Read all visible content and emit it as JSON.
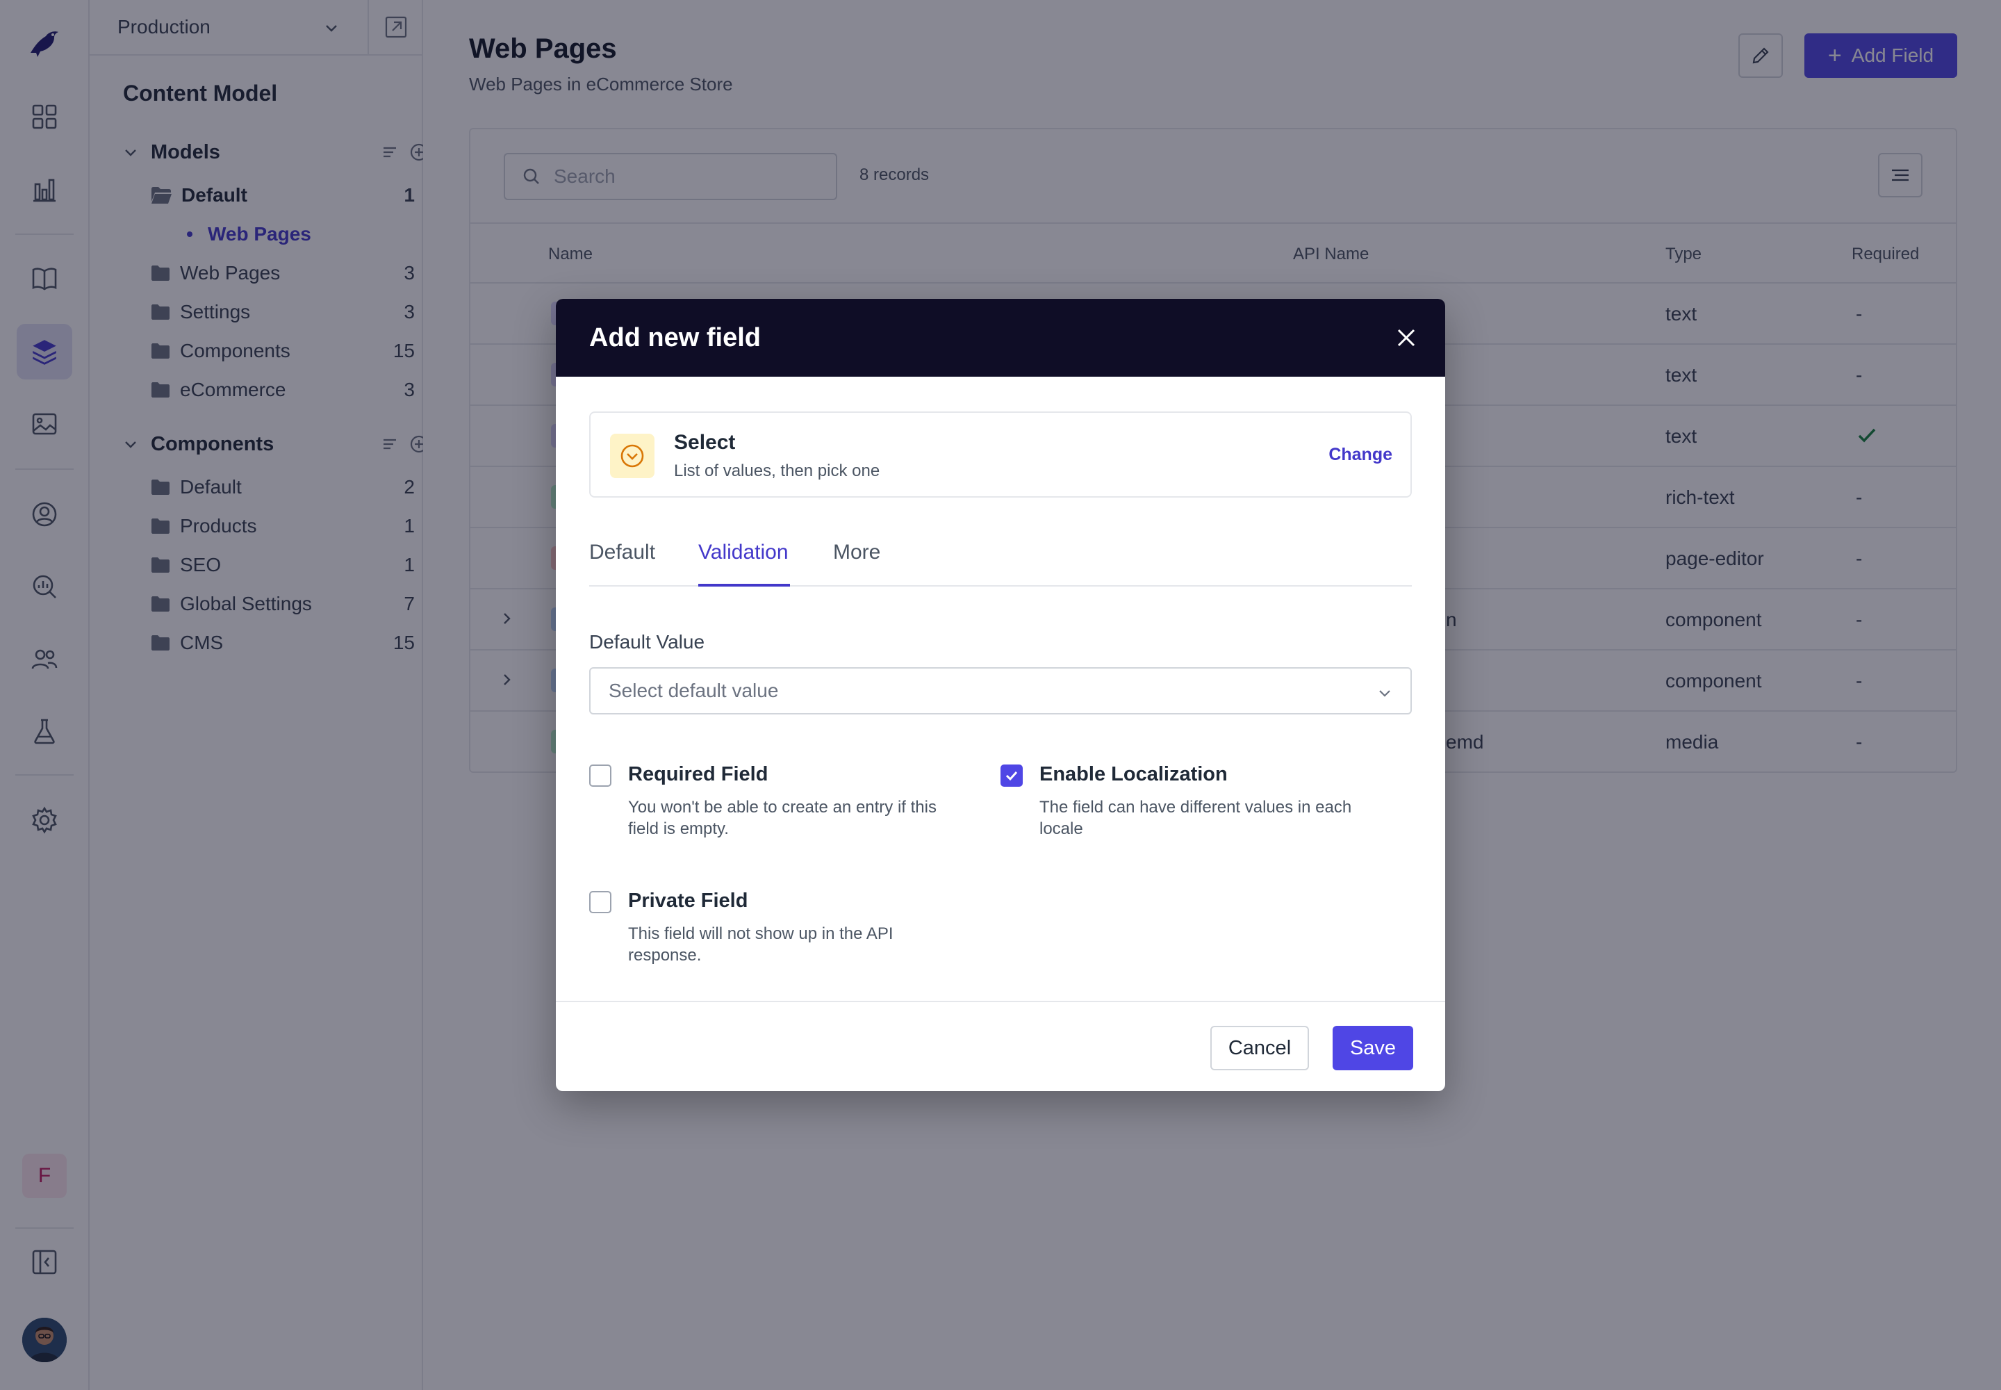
{
  "env": {
    "name": "Production"
  },
  "sidebar": {
    "title": "Content Model",
    "groups": [
      {
        "label": "Models"
      },
      {
        "label": "Components"
      }
    ],
    "models": [
      {
        "label": "Default",
        "count": "1"
      },
      {
        "label": "Web Pages",
        "count": "3"
      },
      {
        "label": "Settings",
        "count": "3"
      },
      {
        "label": "Components",
        "count": "15"
      },
      {
        "label": "eCommerce",
        "count": "3"
      }
    ],
    "models_sub": {
      "label": "Web Pages"
    },
    "components": [
      {
        "label": "Default",
        "count": "2"
      },
      {
        "label": "Products",
        "count": "1"
      },
      {
        "label": "SEO",
        "count": "1"
      },
      {
        "label": "Global Settings",
        "count": "7"
      },
      {
        "label": "CMS",
        "count": "15"
      }
    ]
  },
  "rail": {
    "user_initial": "F"
  },
  "page": {
    "title": "Web Pages",
    "subtitle": "Web Pages in eCommerce Store",
    "add_field_label": "Add Field"
  },
  "table": {
    "search_placeholder": "Search",
    "records": "8 records",
    "headers": {
      "name": "Name",
      "api": "API Name",
      "type": "Type",
      "required": "Required"
    },
    "rows": [
      {
        "api": "",
        "type": "text",
        "required": "-"
      },
      {
        "api": "",
        "type": "text",
        "required": "-"
      },
      {
        "api": "",
        "type": "text",
        "required": ""
      },
      {
        "api": "",
        "type": "rich-text",
        "required": "-"
      },
      {
        "api": "",
        "type": "page-editor",
        "required": "-"
      },
      {
        "api": "n",
        "type": "component",
        "required": "-"
      },
      {
        "api": "",
        "type": "component",
        "required": "-"
      },
      {
        "api": "emd",
        "type": "media",
        "required": "-"
      }
    ]
  },
  "modal": {
    "title": "Add new field",
    "field_type": {
      "name": "Select",
      "description": "List of values, then pick one",
      "change_label": "Change"
    },
    "tabs": [
      {
        "label": "Default"
      },
      {
        "label": "Validation"
      },
      {
        "label": "More"
      }
    ],
    "active_tab": "Validation",
    "default_value": {
      "label": "Default Value",
      "placeholder": "Select default value"
    },
    "options": [
      {
        "title": "Required Field",
        "description": "You won't be able to create an entry if this field is empty.",
        "checked": false
      },
      {
        "title": "Enable Localization",
        "description": "The field can have different values in each locale",
        "checked": true
      },
      {
        "title": "Private Field",
        "description": "This field will not show up in the API response.",
        "checked": false
      }
    ],
    "cancel_label": "Cancel",
    "save_label": "Save"
  },
  "colors": {
    "accent": "#4f46e5",
    "modal_header": "#0f0d26",
    "overlay": "#111127"
  }
}
